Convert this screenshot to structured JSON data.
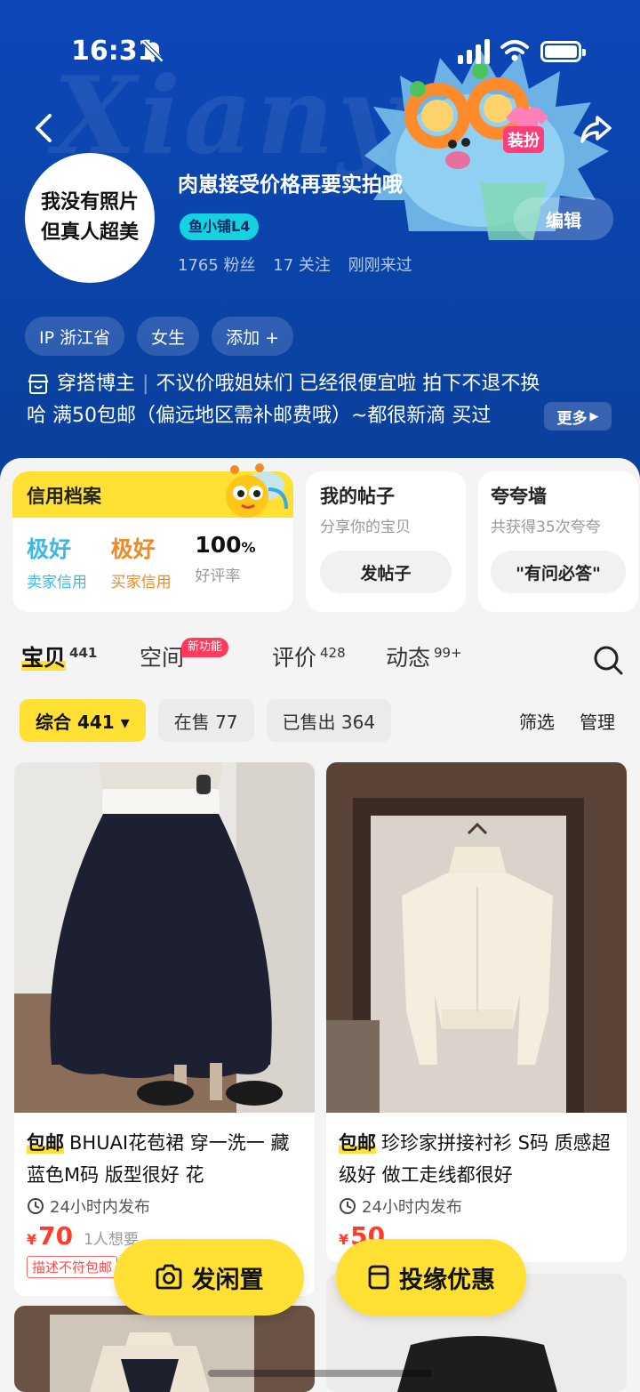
{
  "status": {
    "time": "16:31"
  },
  "profile": {
    "avatar_line1": "我没有照片",
    "avatar_line2": "但真人超美",
    "name": "肉崽接受价格再要实拍哦",
    "badge": "鱼小铺L4",
    "fans": "1765 粉丝",
    "follows": "17 关注",
    "last_seen": "刚刚来过",
    "edit_label": "编辑",
    "dress_label": "装扮",
    "tags": [
      "IP 浙江省",
      "女生",
      "添加 +"
    ],
    "bio_role": "穿搭博主",
    "bio_line1": "不议价哦姐妹们  已经很便宜啦  拍下不退不换",
    "bio_line2": "哈  满50包邮（偏远地区需补邮费哦）~都很新滴  买过",
    "more_label": "更多"
  },
  "credit": {
    "title": "信用档案",
    "seller_value": "极好",
    "seller_label": "卖家信用",
    "buyer_value": "极好",
    "buyer_label": "买家信用",
    "rate_value": "100",
    "rate_unit": "%",
    "rate_label": "好评率",
    "colors": {
      "seller": "#3cb8e8",
      "buyer": "#f08a24"
    }
  },
  "posts": {
    "title": "我的帖子",
    "sub": "分享你的宝贝",
    "button": "发帖子"
  },
  "praise": {
    "title": "夸夸墙",
    "sub": "共获得35次夸夸",
    "button": "\"有问必答\""
  },
  "tabs": [
    {
      "label": "宝贝",
      "count": "441"
    },
    {
      "label": "空间",
      "count": ""
    },
    {
      "label": "评价",
      "count": "428"
    },
    {
      "label": "动态",
      "count": "99+"
    }
  ],
  "new_feature": "新功能",
  "filters": {
    "chips": [
      "综合 441 ▾",
      "在售 77",
      "已售出 364"
    ],
    "screen": "筛选",
    "manage": "管理"
  },
  "products": [
    {
      "free": "包邮",
      "title": "BHUAI花苞裙 穿一洗一 藏蓝色M码 版型很好 花",
      "time": "24小时内发布",
      "yen": "¥",
      "price": "70",
      "want": "1人想要",
      "warn": "描述不符包邮"
    },
    {
      "free": "包邮",
      "title": "珍珍家拼接衬衫 S码 质感超级好 做工走线都很好",
      "time": "24小时内发布",
      "yen": "¥",
      "price": "50",
      "want": "",
      "warn": ""
    }
  ],
  "fab": {
    "post": "发闲置",
    "promo": "投缘优惠"
  }
}
